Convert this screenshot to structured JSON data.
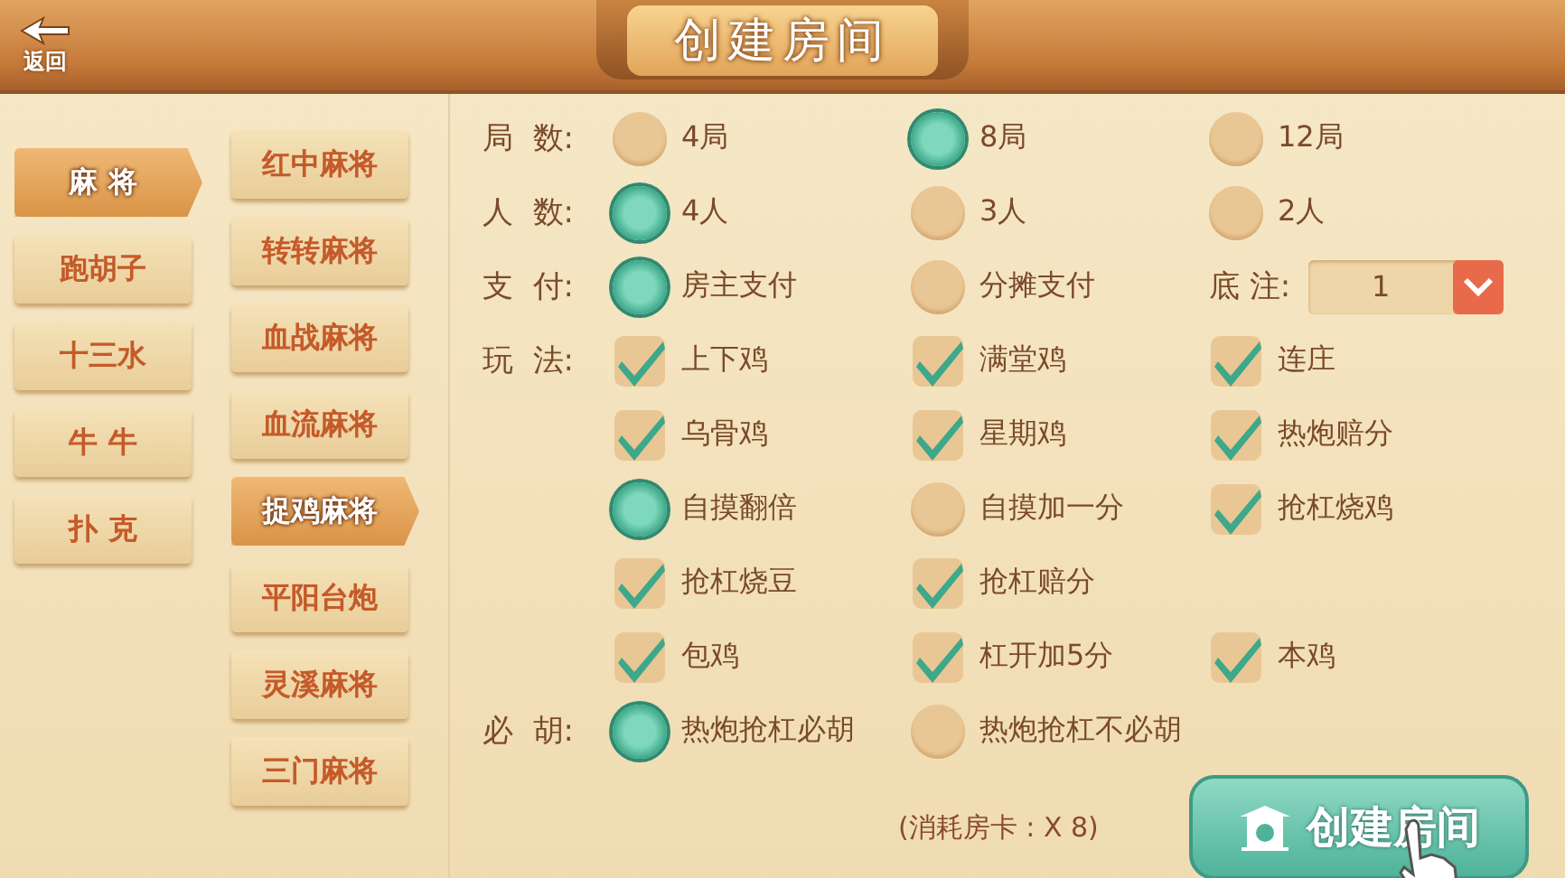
{
  "header": {
    "back_label": "返回",
    "title": "创建房间"
  },
  "categories": [
    {
      "label": "麻 将",
      "selected": true
    },
    {
      "label": "跑胡子",
      "selected": false
    },
    {
      "label": "十三水",
      "selected": false
    },
    {
      "label": "牛 牛",
      "selected": false
    },
    {
      "label": "扑 克",
      "selected": false
    }
  ],
  "variants": [
    {
      "label": "红中麻将",
      "selected": false
    },
    {
      "label": "转转麻将",
      "selected": false
    },
    {
      "label": "血战麻将",
      "selected": false
    },
    {
      "label": "血流麻将",
      "selected": false
    },
    {
      "label": "捉鸡麻将",
      "selected": true
    },
    {
      "label": "平阳台炮",
      "selected": false
    },
    {
      "label": "灵溪麻将",
      "selected": false
    },
    {
      "label": "三门麻将",
      "selected": false
    }
  ],
  "rows": [
    {
      "label": "局  数:",
      "options": [
        {
          "kind": "radio",
          "text": "4局",
          "selected": false
        },
        {
          "kind": "radio",
          "text": "8局",
          "selected": true
        },
        {
          "kind": "radio",
          "text": "12局",
          "selected": false
        }
      ]
    },
    {
      "label": "人  数:",
      "options": [
        {
          "kind": "radio",
          "text": "4人",
          "selected": true
        },
        {
          "kind": "radio",
          "text": "3人",
          "selected": false
        },
        {
          "kind": "radio",
          "text": "2人",
          "selected": false
        }
      ]
    },
    {
      "label": "支  付:",
      "options": [
        {
          "kind": "radio",
          "text": "房主支付",
          "selected": true
        },
        {
          "kind": "radio",
          "text": "分摊支付",
          "selected": false
        }
      ],
      "base": {
        "label": "底 注:",
        "value": "1"
      }
    },
    {
      "label": "玩  法:",
      "options": [
        {
          "kind": "check",
          "text": "上下鸡",
          "checked": true
        },
        {
          "kind": "check",
          "text": "满堂鸡",
          "checked": true
        },
        {
          "kind": "check",
          "text": "连庄",
          "checked": true
        }
      ]
    },
    {
      "options": [
        {
          "kind": "check",
          "text": "乌骨鸡",
          "checked": true
        },
        {
          "kind": "check",
          "text": "星期鸡",
          "checked": true
        },
        {
          "kind": "check",
          "text": "热炮赔分",
          "checked": true
        }
      ]
    },
    {
      "options": [
        {
          "kind": "radio",
          "text": "自摸翻倍",
          "selected": true
        },
        {
          "kind": "radio",
          "text": "自摸加一分",
          "selected": false
        },
        {
          "kind": "check",
          "text": "抢杠烧鸡",
          "checked": true
        }
      ]
    },
    {
      "options": [
        {
          "kind": "check",
          "text": "抢杠烧豆",
          "checked": true
        },
        {
          "kind": "check",
          "text": "抢杠赔分",
          "checked": true
        }
      ]
    },
    {
      "options": [
        {
          "kind": "check",
          "text": "包鸡",
          "checked": true
        },
        {
          "kind": "check",
          "text": "杠开加5分",
          "checked": true
        },
        {
          "kind": "check",
          "text": "本鸡",
          "checked": true
        }
      ]
    },
    {
      "label": "必  胡:",
      "options": [
        {
          "kind": "radio",
          "text": "热炮抢杠必胡",
          "selected": true
        },
        {
          "kind": "radio",
          "text": "热炮抢杠不必胡",
          "selected": false
        }
      ]
    }
  ],
  "cost": "(消耗房卡 : X 8)",
  "create_button": "创建房间"
}
